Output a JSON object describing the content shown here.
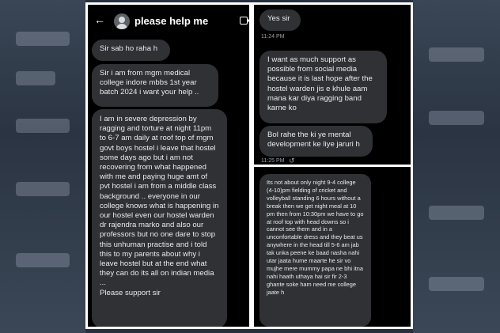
{
  "header": {
    "back_icon": "arrow-left-icon",
    "title": "please help me",
    "video_icon": "video-call-icon"
  },
  "left_messages": [
    "Sir sab ho raha h",
    "Sir i am from mgm medical college indore mbbs 1st year batch 2024  i want your help ..",
    "I am in severe depression by ragging and torture at night 11pm to 6-7 am daily at roof top of mgm govt boys hostel i leave that hostel some days ago but i am not recovering from what happened with me and paying huge amt of pvt hostel i am from a middle class background .. everyone in our college knows what is happening in our hostel even our hostel warden dr rajendra marko and also our professors but no one dare to stop this unhuman practise and i told this to my parents about why i leave hostel but at the end what they can do its all on indian media ...\nPlease support sir"
  ],
  "top_right": {
    "reply": "Yes sir",
    "reply_time": "11:24 PM",
    "messages": [
      "I want as much support as possible from social media because it is last hope after the hostel warden jis e khule aam mana kar diya ragging band karne ko",
      "Bol rahe the ki ye mental development ke liye jaruri h"
    ],
    "time": "11:25 PM",
    "reaction_icon": "retweet-icon"
  },
  "bottom_right": {
    "message": "Its not about only night 9-4 college (4-10)pm fielding of cricket and volleyball standing 6 hours without a break then we get night meal at 10 pm then from 10:30pm we have to go at roof top with head downs so i cannot see them and in a unconfortable dress and they beat us anywhere in the head till 5-6 am jab tak unka peene ke baad nasha nahi utar jaata hume maarte he sir vo mujhe mere mummy papa ne bhi itna nahi haath uthaya hai sir fir 2-3 ghante soke ham need me college jaate h"
  },
  "colors": {
    "bubble": "#2f3134",
    "panel": "#000000",
    "text": "#e8eaed",
    "border": "#ffffff"
  }
}
